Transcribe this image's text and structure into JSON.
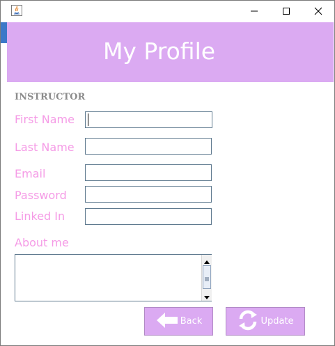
{
  "window": {
    "controls": {
      "minimize_icon": "minimize-icon",
      "maximize_icon": "maximize-icon",
      "close_icon": "close-icon"
    }
  },
  "header": {
    "title": "My Profile",
    "background_color": "#dbaaf2"
  },
  "form": {
    "role": "INSTRUCTOR",
    "label_color": "#f59be6",
    "fields": {
      "first_name": {
        "label": "First Name",
        "value": ""
      },
      "last_name": {
        "label": "Last Name",
        "value": ""
      },
      "email": {
        "label": "Email",
        "value": ""
      },
      "password": {
        "label": "Password",
        "value": ""
      },
      "linked_in": {
        "label": "Linked In",
        "value": ""
      },
      "about_me": {
        "label": "About me",
        "value": ""
      }
    }
  },
  "actions": {
    "back": {
      "label": "Back",
      "icon": "arrow-left-icon"
    },
    "update": {
      "label": "Update",
      "icon": "refresh-icon"
    }
  }
}
